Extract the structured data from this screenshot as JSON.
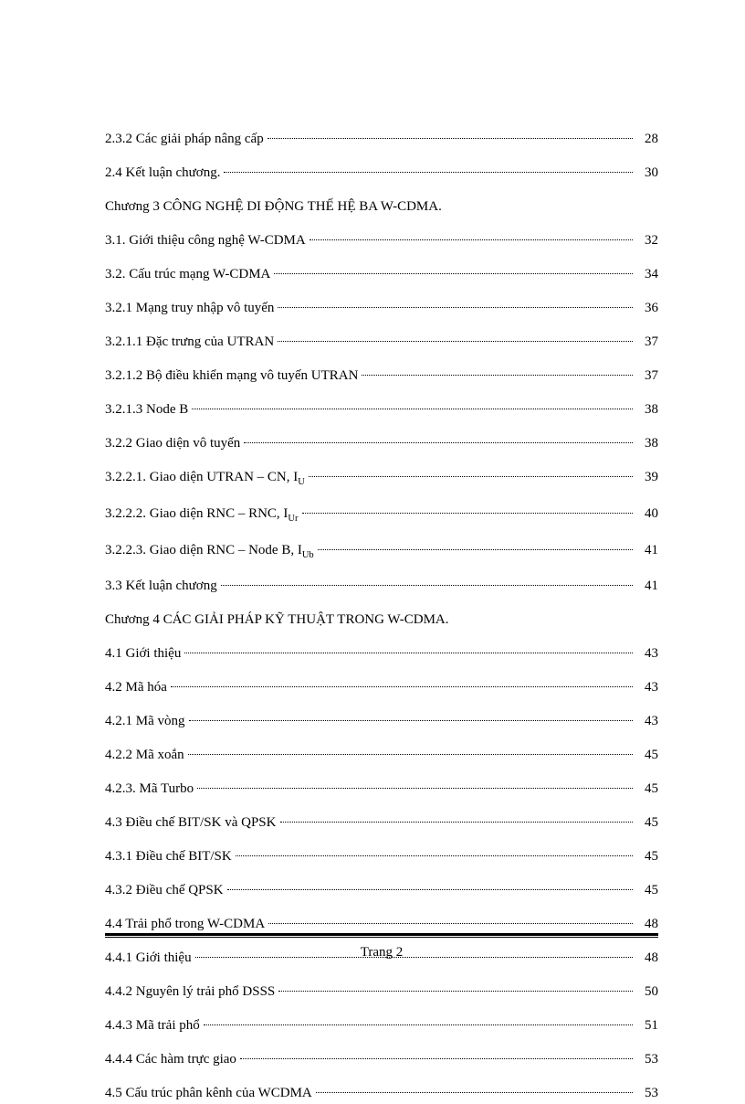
{
  "entries": [
    {
      "type": "dotted",
      "label": "2.3.2   Các  giải pháp nâng cấp ",
      "page": "28"
    },
    {
      "type": "dotted",
      "label": "2.4   Kết luận chương.",
      "page": "30"
    },
    {
      "type": "chapter",
      "label": "Chương 3   CÔNG NGHỆ DI ĐỘNG THẾ HỆ BA W-CDMA."
    },
    {
      "type": "dotted",
      "label": "3.1.  Giới thiệu công nghệ W-CDMA ",
      "page": "32"
    },
    {
      "type": "dotted",
      "label": "3.2.   Cấu trúc mạng  W-CDMA ",
      "page": "34"
    },
    {
      "type": "dotted",
      "label": "3.2.1    Mạng truy nhập vô tuyến ",
      "page": "36"
    },
    {
      "type": "dotted",
      "label": "3.2.1.1    Đặc trưng của UTRAN ",
      "page": "37"
    },
    {
      "type": "dotted",
      "label": "3.2.1.2    Bộ điều khiển mạng  vô tuyến UTRAN ",
      "page": "37"
    },
    {
      "type": "dotted",
      "label": "3.2.1.3    Node B ",
      "page": "38"
    },
    {
      "type": "dotted",
      "label": "3.2.2    Giao diện vô tuyến",
      "page": "38"
    },
    {
      "type": "dotted",
      "label": "3.2.2.1.   Giao diện UTRAN  – CN, I",
      "sub": "U",
      "page": "39"
    },
    {
      "type": "dotted",
      "label": "3.2.2.2.   Giao diện RNC – RNC, I",
      "sub": "Ur",
      "page": "40"
    },
    {
      "type": "dotted",
      "label": "3.2.2.3.   Giao diện RNC – Node B, I",
      "sub": "Ub",
      "page": "41"
    },
    {
      "type": "dotted",
      "label": "3.3    Kết luận chương ",
      "page": "41"
    },
    {
      "type": "chapter",
      "label": "Chương 4  CÁC GIẢI PHÁP KỸ THUẬT  TRONG W-CDMA."
    },
    {
      "type": "dotted",
      "label": "4.1   Giới thiệu ",
      "page": "43"
    },
    {
      "type": "dotted",
      "label": "4.2   Mã hóa ",
      "page": "43"
    },
    {
      "type": "dotted",
      "label": "4.2.1   Mã vòng ",
      "page": "43"
    },
    {
      "type": "dotted",
      "label": "4.2.2   Mã xoắn ",
      "page": "45"
    },
    {
      "type": "dotted",
      "label": "4.2.3.  Mã Turbo ",
      "page": "45"
    },
    {
      "type": "dotted",
      "label": "4.3    Điều chế BIT/SK và QPSK ",
      "page": "45"
    },
    {
      "type": "dotted",
      "label": "4.3.1   Điều chế BIT/SK ",
      "page": "45"
    },
    {
      "type": "dotted",
      "label": "4.3.2   Điều chế QPSK",
      "page": "45"
    },
    {
      "type": "dotted",
      "label": "4.4   Trải phổ trong W-CDMA ",
      "page": "48"
    },
    {
      "type": "dotted",
      "label": "4.4.1   Giới thiệu",
      "page": "48"
    },
    {
      "type": "dotted",
      "label": "4.4.2   Nguyên  lý trải phổ DSSS ",
      "page": "50"
    },
    {
      "type": "dotted",
      "label": "4.4.3   Mã trải phổ",
      "page": "51"
    },
    {
      "type": "dotted",
      "label": "4.4.4   Các hàm trực giao ",
      "page": "53"
    },
    {
      "type": "dotted",
      "label": "4.5   Cấu trúc phân kênh của WCDMA ",
      "page": "53"
    }
  ],
  "footer": "Trang  2"
}
